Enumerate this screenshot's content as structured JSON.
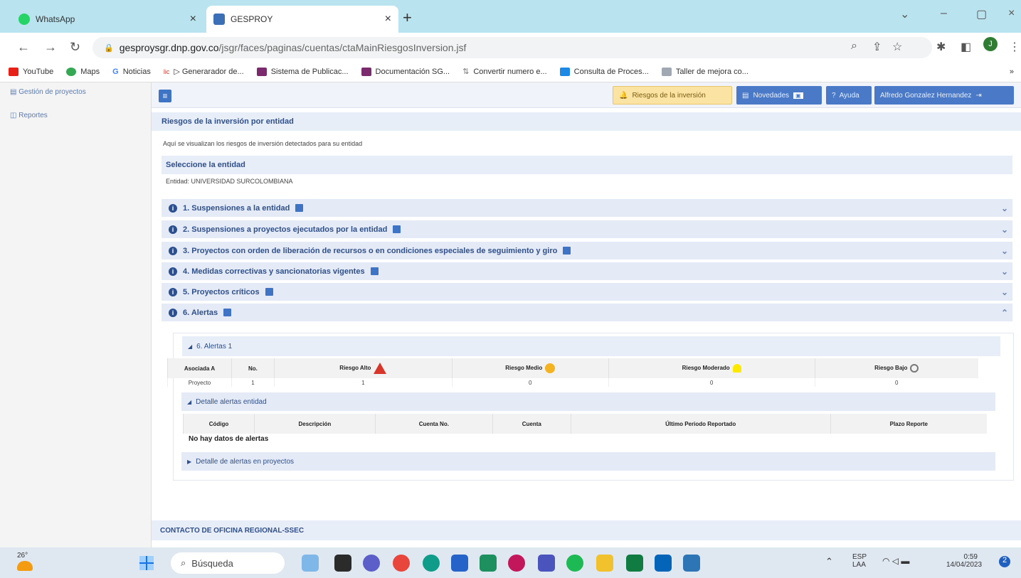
{
  "browser": {
    "tabs": [
      {
        "title": "WhatsApp",
        "icon": "whatsapp-icon",
        "active": false
      },
      {
        "title": "GESPROY",
        "icon": "gesproy-icon",
        "active": true
      }
    ],
    "url_host": "gesproysgr.dnp.gov.co",
    "url_path": "/jsgr/faces/paginas/cuentas/ctaMainRiesgosInversion.jsf",
    "bookmarks": [
      "YouTube",
      "Maps",
      "Noticias",
      "▷ Generarador de...",
      "Sistema de Publicac...",
      "Documentación SG...",
      "Convertir numero e...",
      "Consulta de Proces...",
      "Taller de mejora co..."
    ],
    "profile_initial": "J"
  },
  "sidebar": {
    "items": [
      "Gestión de proyectos",
      "Reportes"
    ]
  },
  "topbar": {
    "risk_label": "Riesgos de la inversión",
    "news_label": "Novedades",
    "help_label": "Ayuda",
    "user_label": "Alfredo Gonzalez Hernandez"
  },
  "page": {
    "title": "Riesgos de la inversión por entidad",
    "description": "Aquí se visualizan los riesgos de inversión detectados para su entidad",
    "select_title": "Seleccione la entidad",
    "entity_text": "Entidad: UNIVERSIDAD SURCOLOMBIANA",
    "sections": [
      {
        "label": "1. Suspensiones a la entidad",
        "expanded": false
      },
      {
        "label": "2. Suspensiones a proyectos ejecutados por la entidad",
        "expanded": false
      },
      {
        "label": "3. Proyectos con orden de liberación de recursos o en condiciones especiales de seguimiento y giro",
        "expanded": false
      },
      {
        "label": "4. Medidas correctivas y sancionatorias vigentes",
        "expanded": false
      },
      {
        "label": "5. Proyectos críticos",
        "expanded": false
      },
      {
        "label": "6. Alertas",
        "expanded": true
      }
    ],
    "alerts_panel": {
      "title": "6. Alertas 1",
      "headers": [
        "Asociada A",
        "No.",
        "Riesgo Alto",
        "Riesgo Medio",
        "Riesgo Moderado",
        "Riesgo Bajo"
      ],
      "row": [
        "Proyecto",
        "1",
        "1",
        "0",
        "0",
        "0"
      ],
      "entity_detail_title": "Detalle alertas entidad",
      "detail_headers": [
        "Código",
        "Descripción",
        "Cuenta No.",
        "Cuenta",
        "Último Periodo Reportado",
        "Plazo Reporte"
      ],
      "no_data": "No hay datos de alertas",
      "project_detail_title": "Detalle de alertas en proyectos"
    },
    "contact": "CONTACTO DE OFICINA REGIONAL-SSEC"
  },
  "taskbar": {
    "weather": "26°",
    "search_placeholder": "Búsqueda",
    "lang": "ESP",
    "lang2": "LAA",
    "time": "0:59",
    "date": "14/04/2023"
  }
}
